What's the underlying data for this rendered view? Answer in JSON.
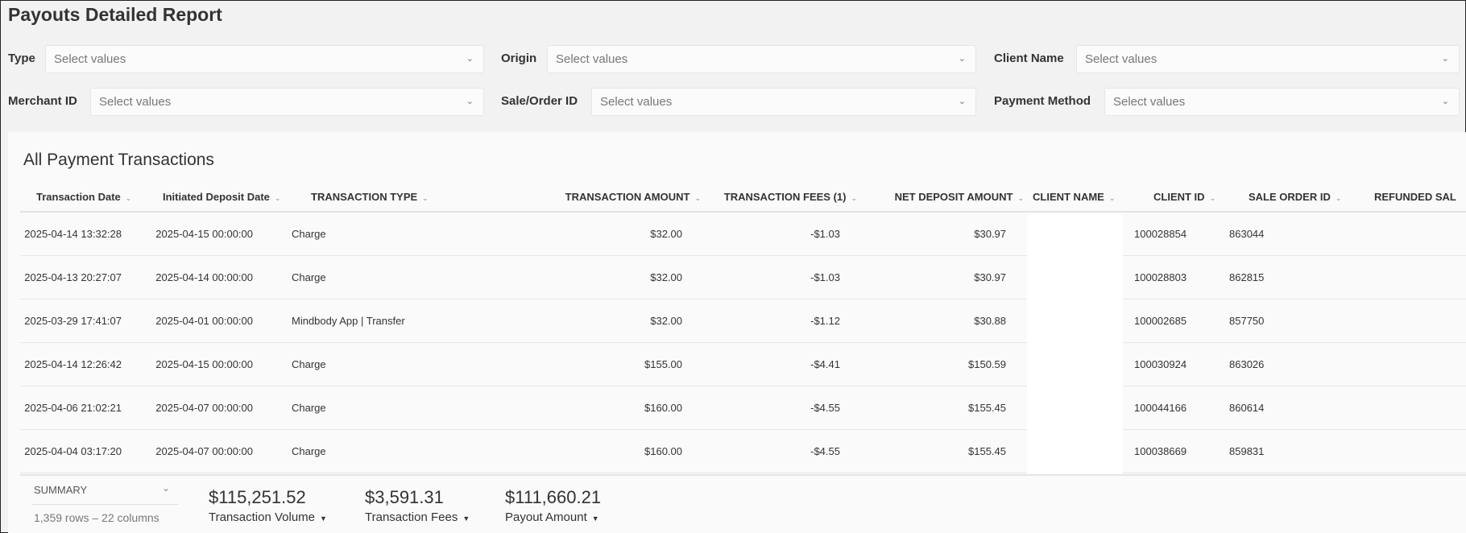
{
  "title": "Payouts Detailed Report",
  "filters": [
    {
      "label": "Type",
      "placeholder": "Select values"
    },
    {
      "label": "Origin",
      "placeholder": "Select values"
    },
    {
      "label": "Client Name",
      "placeholder": "Select values"
    },
    {
      "label": "Merchant ID",
      "placeholder": "Select values"
    },
    {
      "label": "Sale/Order ID",
      "placeholder": "Select values"
    },
    {
      "label": "Payment Method",
      "placeholder": "Select values"
    }
  ],
  "table": {
    "title": "All Payment Transactions",
    "columns": [
      "Transaction Date",
      "Initiated Deposit Date",
      "TRANSACTION TYPE",
      "TRANSACTION AMOUNT",
      "TRANSACTION FEES (1)",
      "NET DEPOSIT AMOUNT",
      "CLIENT NAME",
      "CLIENT ID",
      "SALE ORDER ID",
      "REFUNDED SAL"
    ],
    "rows": [
      [
        "2025-04-14 13:32:28",
        "2025-04-15 00:00:00",
        "Charge",
        "$32.00",
        "-$1.03",
        "$30.97",
        "",
        "100028854",
        "863044"
      ],
      [
        "2025-04-13 20:27:07",
        "2025-04-14 00:00:00",
        "Charge",
        "$32.00",
        "-$1.03",
        "$30.97",
        "",
        "100028803",
        "862815"
      ],
      [
        "2025-03-29 17:41:07",
        "2025-04-01 00:00:00",
        "Mindbody App | Transfer",
        "$32.00",
        "-$1.12",
        "$30.88",
        "",
        "100002685",
        "857750"
      ],
      [
        "2025-04-14 12:26:42",
        "2025-04-15 00:00:00",
        "Charge",
        "$155.00",
        "-$4.41",
        "$150.59",
        "",
        "100030924",
        "863026"
      ],
      [
        "2025-04-06 21:02:21",
        "2025-04-07 00:00:00",
        "Charge",
        "$160.00",
        "-$4.55",
        "$155.45",
        "",
        "100044166",
        "860614"
      ],
      [
        "2025-04-04 03:17:20",
        "2025-04-07 00:00:00",
        "Charge",
        "$160.00",
        "-$4.55",
        "$155.45",
        "",
        "100038669",
        "859831"
      ]
    ]
  },
  "summary": {
    "label": "SUMMARY",
    "rows_info": "1,359 rows – 22 columns",
    "metrics": [
      {
        "value": "$115,251.52",
        "label": "Transaction Volume"
      },
      {
        "value": "$3,591.31",
        "label": "Transaction Fees"
      },
      {
        "value": "$111,660.21",
        "label": "Payout Amount"
      }
    ]
  }
}
